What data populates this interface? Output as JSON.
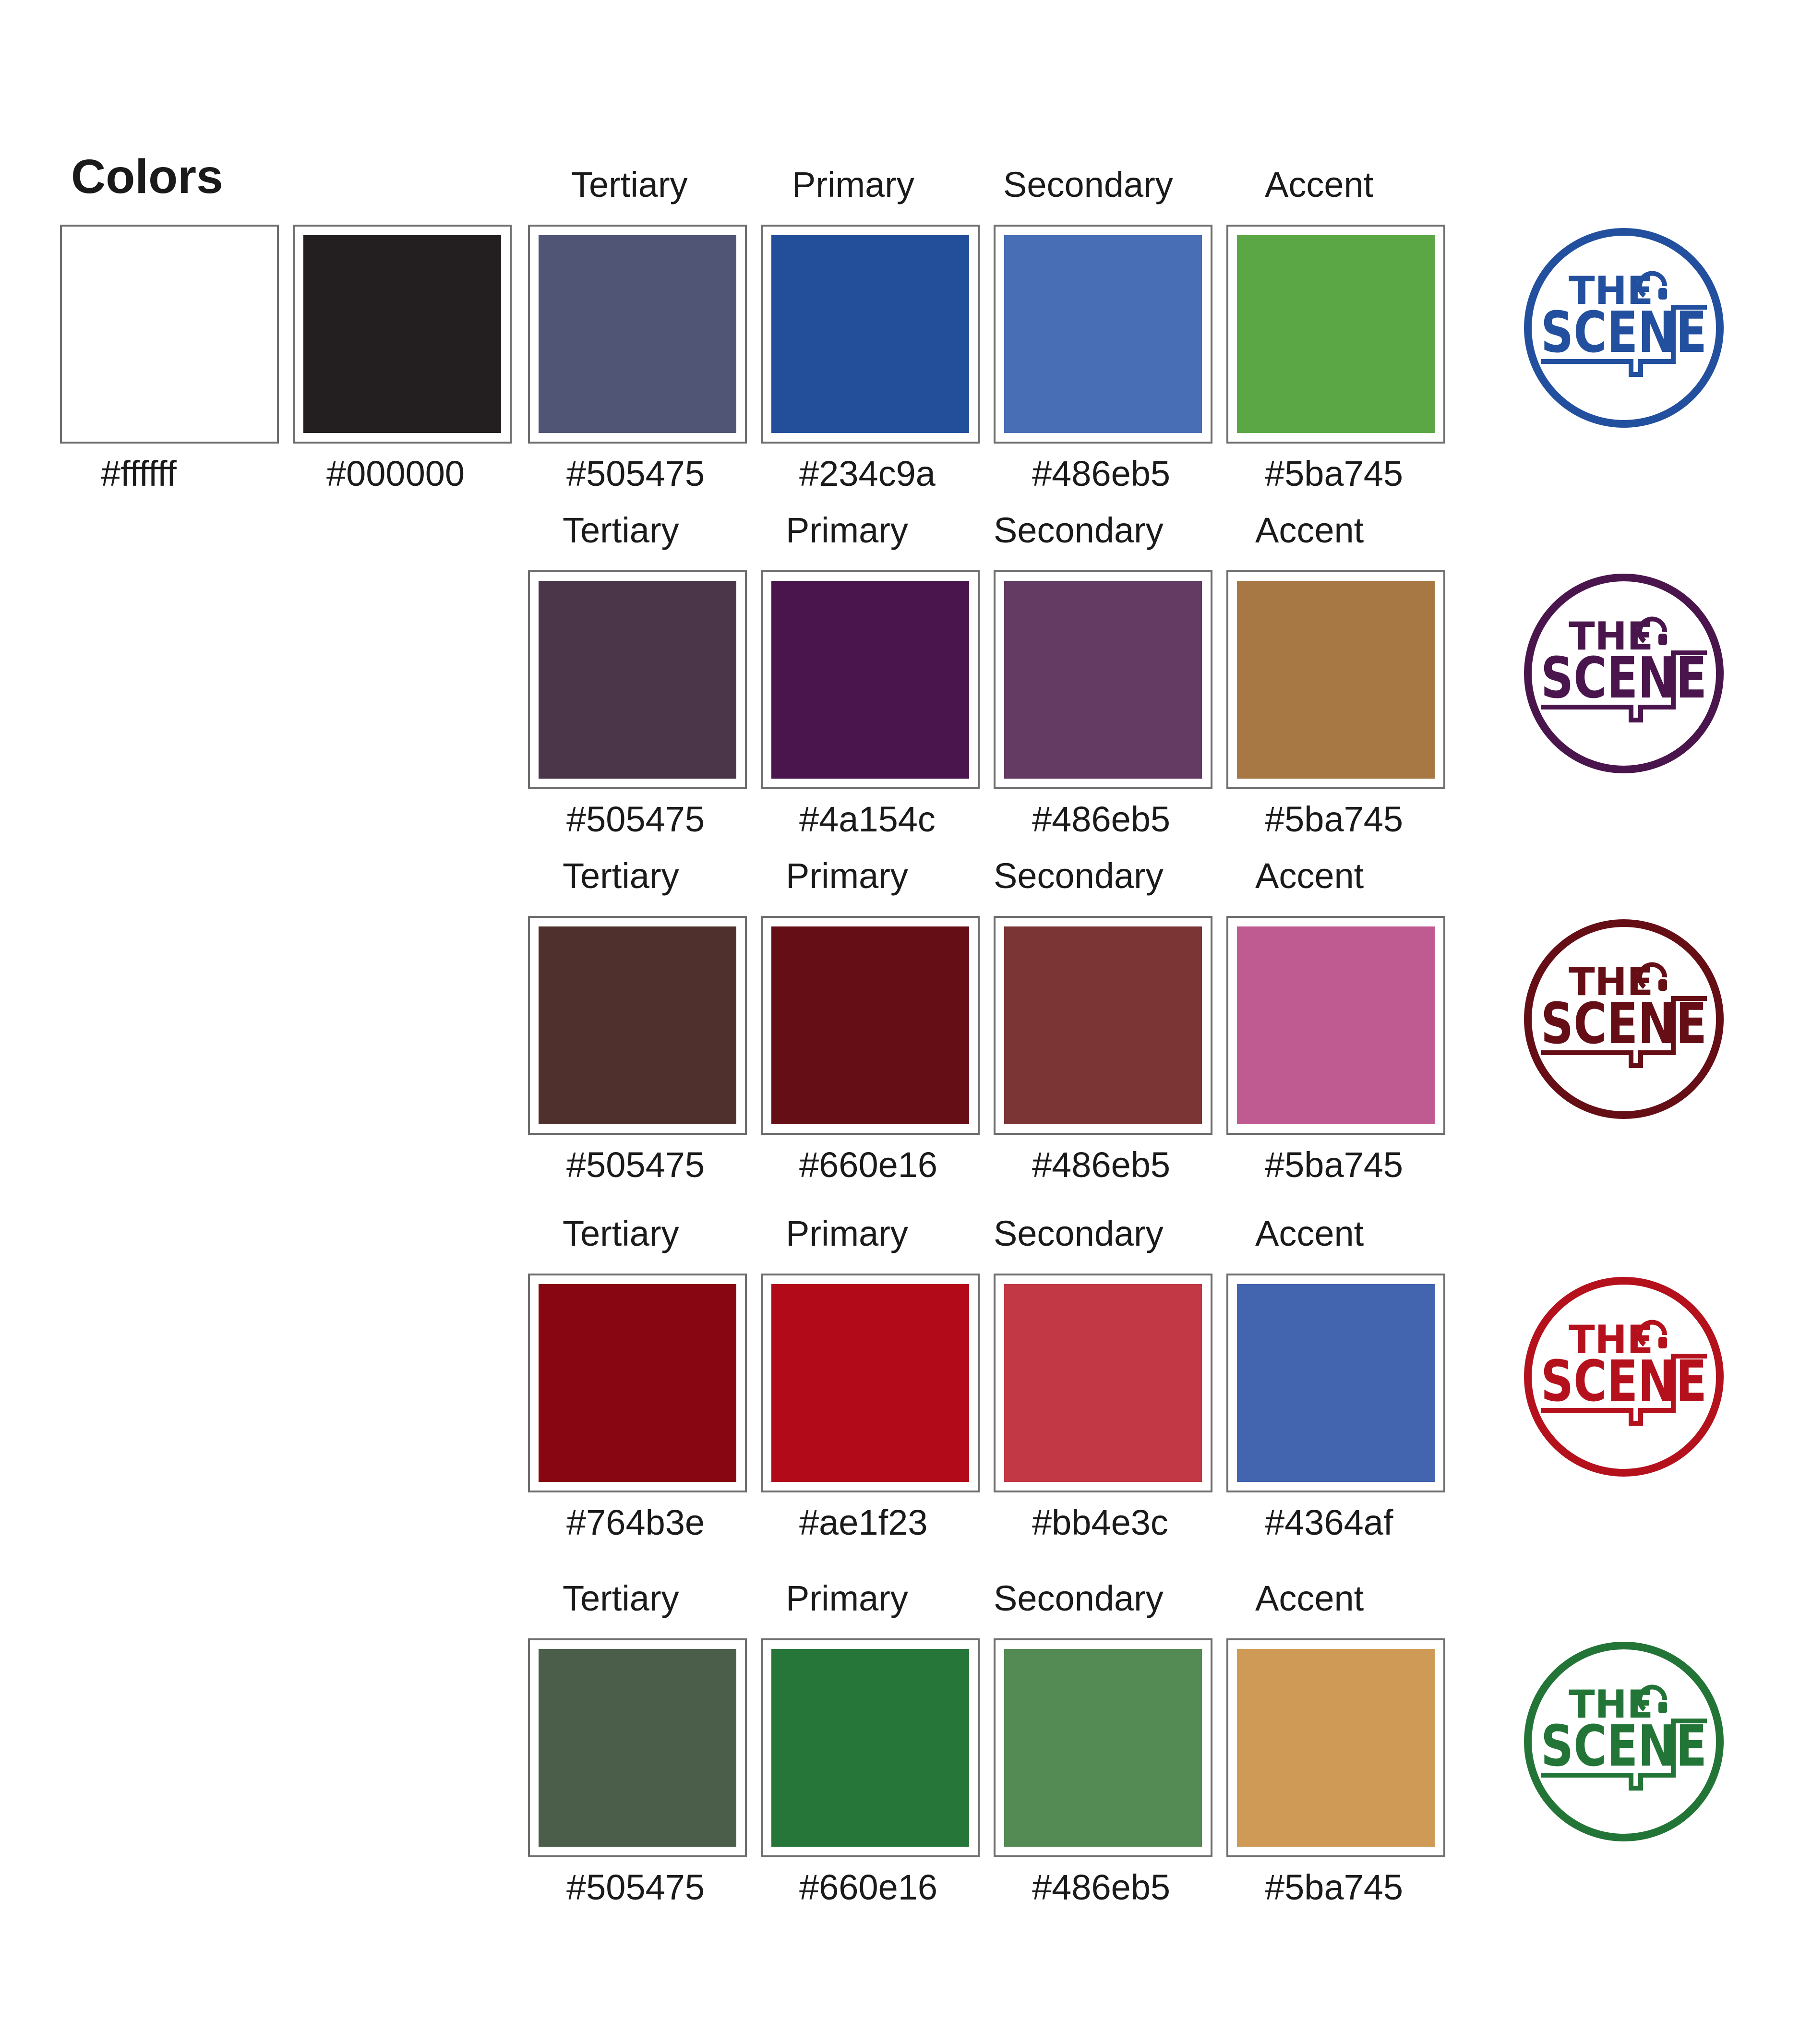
{
  "page": {
    "title": "Colors"
  },
  "base_swatches": [
    {
      "hex": "#ffffff",
      "color": "#ffffff"
    },
    {
      "hex": "#000000",
      "color": "#231f20"
    }
  ],
  "palettes": [
    {
      "logo": {
        "line1": "THE",
        "line2": "SCENE",
        "icon": "headphones-icon",
        "color": "#23509e"
      },
      "swatches": [
        {
          "role": "Tertiary",
          "hex": "#505475",
          "color": "#505475"
        },
        {
          "role": "Primary",
          "hex": "#234c9a",
          "color": "#234f9a"
        },
        {
          "role": "Secondary",
          "hex": "#486eb5",
          "color": "#486eb5"
        },
        {
          "role": "Accent",
          "hex": "#5ba745",
          "color": "#5ba745"
        }
      ]
    },
    {
      "logo": {
        "line1": "THE",
        "line2": "SCENE",
        "icon": "headphones-icon",
        "color": "#4a154c"
      },
      "swatches": [
        {
          "role": "Tertiary",
          "hex": "#505475",
          "color": "#4a3549"
        },
        {
          "role": "Primary",
          "hex": "#4a154c",
          "color": "#4a154c"
        },
        {
          "role": "Secondary",
          "hex": "#486eb5",
          "color": "#633b63"
        },
        {
          "role": "Accent",
          "hex": "#5ba745",
          "color": "#a77843"
        }
      ]
    },
    {
      "logo": {
        "line1": "THE",
        "line2": "SCENE",
        "icon": "headphones-icon",
        "color": "#660e16"
      },
      "swatches": [
        {
          "role": "Tertiary",
          "hex": "#505475",
          "color": "#50302c"
        },
        {
          "role": "Primary",
          "hex": "#660e16",
          "color": "#660e16"
        },
        {
          "role": "Secondary",
          "hex": "#486eb5",
          "color": "#7c3535"
        },
        {
          "role": "Accent",
          "hex": "#5ba745",
          "color": "#c05b92"
        }
      ]
    },
    {
      "logo": {
        "line1": "THE",
        "line2": "SCENE",
        "icon": "headphones-icon",
        "color": "#b5111d"
      },
      "swatches": [
        {
          "role": "Tertiary",
          "hex": "#764b3e",
          "color": "#880512"
        },
        {
          "role": "Primary",
          "hex": "#ae1f23",
          "color": "#b30a1a"
        },
        {
          "role": "Secondary",
          "hex": "#bb4e3c",
          "color": "#c23845"
        },
        {
          "role": "Accent",
          "hex": "#4364af",
          "color": "#4364af"
        }
      ]
    },
    {
      "logo": {
        "line1": "THE",
        "line2": "SCENE",
        "icon": "headphones-icon",
        "color": "#237537"
      },
      "swatches": [
        {
          "role": "Tertiary",
          "hex": "#505475",
          "color": "#4a5e4a"
        },
        {
          "role": "Primary",
          "hex": "#660e16",
          "color": "#257638"
        },
        {
          "role": "Secondary",
          "hex": "#486eb5",
          "color": "#548a53"
        },
        {
          "role": "Accent",
          "hex": "#5ba745",
          "color": "#cf9a55"
        }
      ]
    }
  ]
}
